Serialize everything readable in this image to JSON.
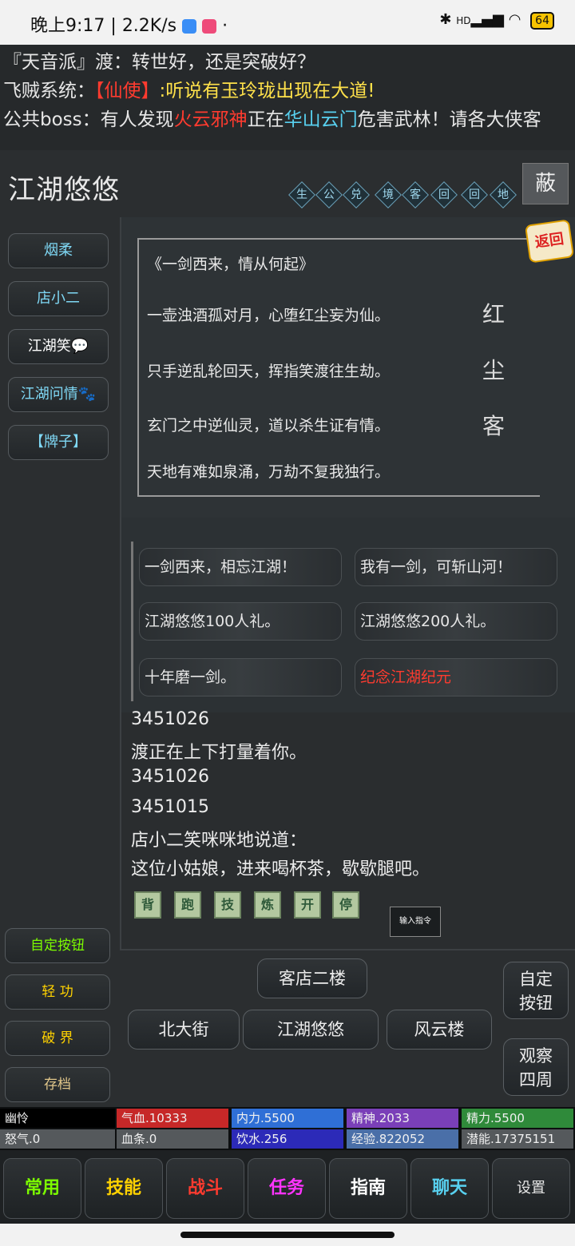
{
  "status_bar": {
    "time": "晚上9:17",
    "speed": "2.2K/s",
    "battery": "64",
    "signal": "HD"
  },
  "broadcast": {
    "line1": {
      "prefix": "『天音派』渡",
      "text": "：转世好，还是突破好？"
    },
    "line2": {
      "prefix": "飞贼系统：",
      "bracket": "【仙使】",
      "mid": ":听说有玉玲珑出现在",
      "place": "大道",
      "end": "!"
    },
    "line3": {
      "prefix": "公共boss：有人发现",
      "boss": "火云邪神",
      "mid": "正在",
      "place": "华山云门",
      "end": "危害武林！请各大侠客"
    }
  },
  "header": {
    "title": "江湖悠悠",
    "buttons": [
      "生",
      "公",
      "兑",
      "境",
      "客",
      "回",
      "回",
      "地"
    ],
    "hide_label": "蔽"
  },
  "npc_list": [
    "烟柔",
    "店小二",
    "江湖笑💬",
    "江湖问情🐾",
    "【牌子】"
  ],
  "side_buttons": [
    "自定按钮",
    "轻 功",
    "破 界",
    "存档"
  ],
  "poem": {
    "return_label": "返回",
    "title": "《一剑西来，情从何起》",
    "lines": [
      "一壶浊酒孤对月，心堕红尘妄为仙。",
      "只手逆乱轮回天，挥指笑渡往生劫。",
      "玄门之中逆仙灵，道以杀生证有情。",
      "天地有难如泉涌，万劫不复我独行。"
    ],
    "side_chars": [
      "红",
      "尘",
      "客"
    ]
  },
  "options": [
    "一剑西来，相忘江湖！",
    "我有一剑，可斩山河！",
    "江湖悠悠100人礼。",
    "江湖悠悠200人礼。",
    "十年磨一剑。",
    "纪念江湖纪元"
  ],
  "log": [
    "3451026",
    "渡正在上下打量着你。",
    "3451026",
    "3451015",
    "店小二笑咪咪地说道：",
    "这位小姑娘，进来喝杯茶，歇歇腿吧。"
  ],
  "quick_buttons": [
    "背",
    "跑",
    "技",
    "炼",
    "开",
    "停"
  ],
  "command_button": "输入指令",
  "nav": {
    "north": "客店二楼",
    "west": "北大街",
    "center": "江湖悠悠",
    "east": "风云楼",
    "custom": "自定\n按钮",
    "look": "观察\n四周"
  },
  "stats": {
    "name": "幽怜",
    "hp": "气血.10333",
    "neili": "内力.5500",
    "jingshen": "精神.2033",
    "jingli": "精力.5500",
    "nuqi": "怒气.0",
    "xuetiao": "血条.0",
    "yinshui": "饮水.256",
    "exp": "经验.822052",
    "qianneng": "潜能.17375151"
  },
  "tabs": [
    "常用",
    "技能",
    "战斗",
    "任务",
    "指南",
    "聊天",
    "设置"
  ],
  "colors": {
    "red": "#ff3b2f",
    "yellow": "#ffe14a",
    "cyan": "#58d1f0",
    "gold": "#ffd200",
    "green": "#7CFC00",
    "magenta": "#ff33ff"
  }
}
